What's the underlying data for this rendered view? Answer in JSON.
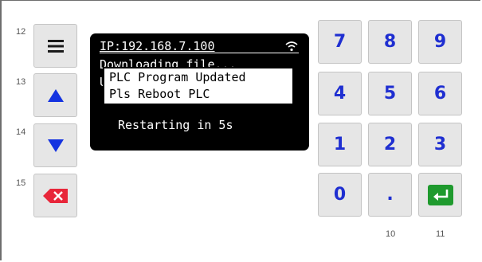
{
  "left_panel": {
    "row_numbers": [
      "12",
      "13",
      "14",
      "15"
    ],
    "menu_icon": "hamburger-menu-icon",
    "up_icon": "triangle-up-icon",
    "down_icon": "triangle-down-icon",
    "clear_icon": "backspace-delete-icon"
  },
  "display": {
    "ip_line": "IP:192.168.7.100",
    "wifi_icon": "wifi-icon",
    "downloading_line": "Downloading file...",
    "hidden_line_char": "U",
    "restart_line": "Restarting in 5s"
  },
  "popup": {
    "line1": "PLC Program Updated",
    "line2": "Pls Reboot PLC"
  },
  "keypad": {
    "keys": [
      "7",
      "8",
      "9",
      "4",
      "5",
      "6",
      "1",
      "2",
      "3",
      "0",
      "."
    ],
    "enter_icon": "enter-return-icon",
    "column_numbers": [
      "10",
      "11"
    ]
  },
  "colors": {
    "digit": "#1f2fd1",
    "arrow": "#1433e0",
    "clear": "#e8263a",
    "enter": "#1f9a2e",
    "lcd_background": "#000000"
  }
}
